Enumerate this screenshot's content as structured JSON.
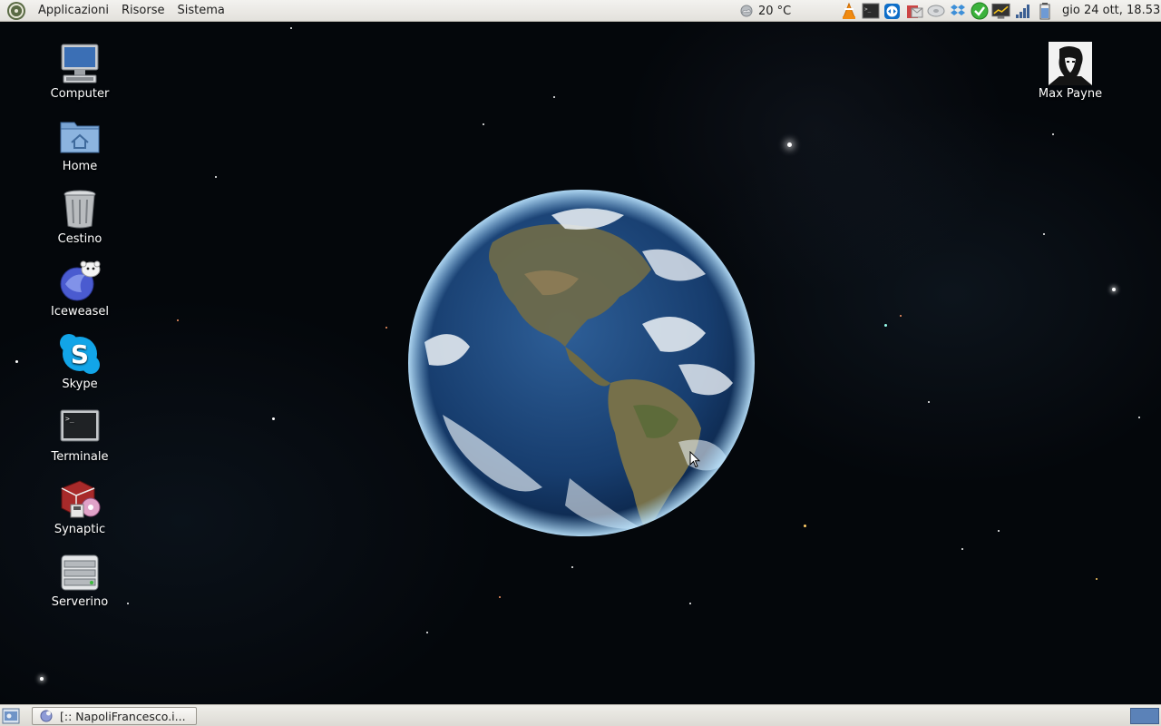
{
  "top_panel": {
    "menus": [
      "Applicazioni",
      "Risorse",
      "Sistema"
    ],
    "weather": {
      "icon": "weather-cloud-icon",
      "temperature": "20 °C"
    },
    "tray_icons": [
      "vlc-icon",
      "terminal-icon",
      "teamviewer-icon",
      "mail-icon",
      "disk-icon",
      "dropbox-icon",
      "update-check-icon",
      "monitor-icon",
      "network-signal-icon",
      "battery-icon"
    ],
    "clock": "gio 24 ott, 18.53"
  },
  "desktop": {
    "icons_left": [
      {
        "label": "Computer",
        "icon": "computer-icon"
      },
      {
        "label": "Home",
        "icon": "home-folder-icon"
      },
      {
        "label": "Cestino",
        "icon": "trash-icon"
      },
      {
        "label": "Iceweasel",
        "icon": "iceweasel-icon"
      },
      {
        "label": "Skype",
        "icon": "skype-icon"
      },
      {
        "label": "Terminale",
        "icon": "terminal-icon"
      },
      {
        "label": "Synaptic",
        "icon": "synaptic-icon"
      },
      {
        "label": "Serverino",
        "icon": "server-drive-icon"
      }
    ],
    "icons_right": [
      {
        "label": "Max Payne",
        "icon": "max-payne-icon"
      }
    ],
    "wallpaper": "earth-from-space"
  },
  "bottom_panel": {
    "taskbar_items": [
      {
        "label": "[:: NapoliFrancesco.i...",
        "icon": "iceweasel-icon"
      }
    ]
  },
  "colors": {
    "panel_bg": "#e8e6e1",
    "workspace_active": "#5b82b8",
    "desktop_bg": "#04070b"
  }
}
